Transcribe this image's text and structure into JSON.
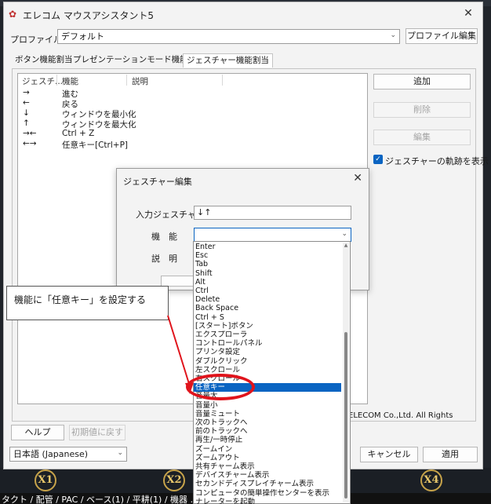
{
  "window": {
    "title": "エレコム マウスアシスタント5",
    "profile_label": "プロファイル:",
    "profile_value": "デフォルト",
    "profile_edit": "プロファイル編集",
    "tabs": [
      "ボタン機能割当",
      "プレゼンテーションモード機能割当",
      "ジェスチャー機能割当"
    ],
    "list_headers": [
      "ジェスチ...",
      "機能",
      "説明"
    ],
    "rows": [
      {
        "gesture": "→",
        "func": "進む"
      },
      {
        "gesture": "←",
        "func": "戻る"
      },
      {
        "gesture": "↓",
        "func": "ウィンドウを最小化"
      },
      {
        "gesture": "↑",
        "func": "ウィンドウを最大化"
      },
      {
        "gesture": "→←",
        "func": "Ctrl + Z"
      },
      {
        "gesture": "←→",
        "func": "任意キー[Ctrl+P]"
      }
    ],
    "add": "追加",
    "delete": "削除",
    "edit": "編集",
    "show_trail": "ジェスチャーの軌跡を表示",
    "copyright": "ELECOM Co.,Ltd. All Rights",
    "help": "ヘルプ",
    "reset": "初期値に戻す",
    "language": "日本語 (Japanese)",
    "cancel": "キャンセル",
    "apply": "適用"
  },
  "dialog": {
    "title": "ジェスチャー編集",
    "input_label": "入力ジェスチャー",
    "input_value": "↓↑",
    "func_label": "機　能",
    "desc_label": "説　明"
  },
  "dropdown": {
    "items": [
      "Enter",
      "Esc",
      "Tab",
      "Shift",
      "Alt",
      "Ctrl",
      "Delete",
      "Back Space",
      "Ctrl + S",
      "[スタート]ボタン",
      "エクスプローラ",
      "コントロールパネル",
      "プリンタ設定",
      "ダブルクリック",
      "左スクロール",
      "右スクロール",
      "任意キー",
      "音量大",
      "音量小",
      "音量ミュート",
      "次のトラックへ",
      "前のトラックへ",
      "再生/一時停止",
      "ズームイン",
      "ズームアウト",
      "共有チャーム表示",
      "デバイスチャーム表示",
      "セカンドディスプレイチャーム表示",
      "コンピュータの簡単操作センターを表示",
      "ナレーターを起動"
    ],
    "selected_index": 16
  },
  "annotation": {
    "text": "機能に「任意キー」を設定する"
  },
  "background": {
    "badges": [
      "X1",
      "X2",
      "X4"
    ],
    "strip": "タクト / 配管 / PAC / ベース(1) / 平耕(1) / 機器 … 冷媒 /"
  },
  "colors": {
    "accent": "#0a64c2",
    "annotation": "#e0141c"
  }
}
